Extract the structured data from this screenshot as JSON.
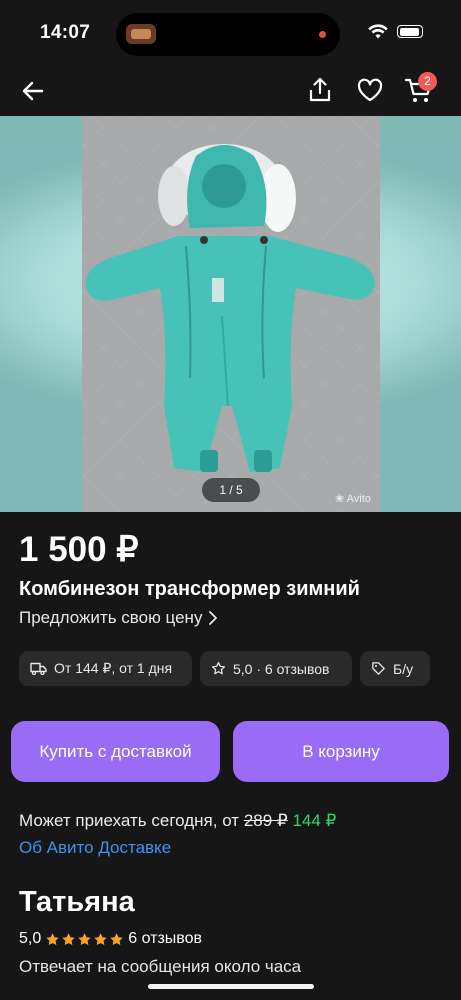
{
  "status_bar": {
    "time": "14:07"
  },
  "nav": {
    "cart_count": "2"
  },
  "gallery": {
    "counter": "1 / 5",
    "watermark": "Avito"
  },
  "listing": {
    "price": "1 500 ₽",
    "title": "Комбинезон трансформер зимний",
    "offer_price": "Предложить свою цену"
  },
  "chips": {
    "delivery": "От 144 ₽, от 1 дня",
    "rating": "5,0 · 6 отзывов",
    "condition": "Б/у"
  },
  "buttons": {
    "buy_delivery": "Купить с доставкой",
    "add_to_cart": "В корзину"
  },
  "delivery": {
    "prefix": "Может приехать сегодня, от",
    "old_price": "289 ₽",
    "new_price": "144 ₽",
    "link": "Об Авито Доставке"
  },
  "seller": {
    "name": "Татьяна",
    "rating": "5,0",
    "reviews": "6 отзывов",
    "response_time": "Отвечает на сообщения около часа"
  },
  "colors": {
    "accent": "#9a6bf4",
    "link": "#3d93f0",
    "price_green": "#2fd66b",
    "star": "#f5a623",
    "badge": "#f25a5a"
  },
  "icons": [
    "back-arrow-icon",
    "share-icon",
    "heart-icon",
    "cart-icon",
    "truck-icon",
    "star-icon",
    "tag-icon",
    "chevron-right-icon",
    "wifi-icon",
    "battery-icon"
  ]
}
